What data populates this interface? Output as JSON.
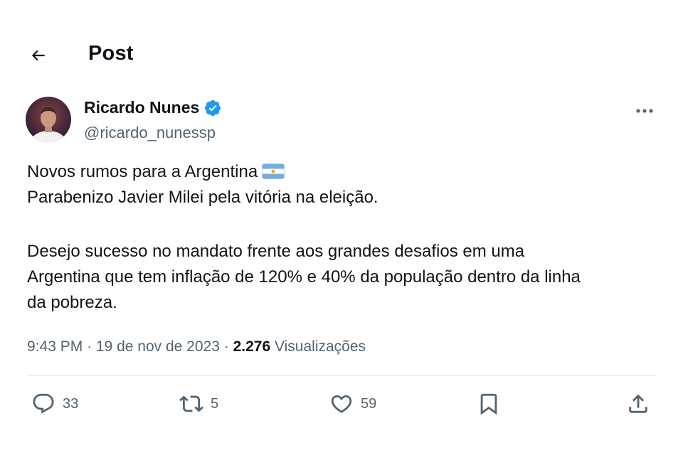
{
  "header": {
    "title": "Post"
  },
  "author": {
    "name": "Ricardo Nunes",
    "handle": "@ricardo_nunessp"
  },
  "tweet": {
    "line1": "Novos rumos para a Argentina",
    "line2": "Parabenizo Javier Milei pela vitória na eleição.",
    "line3": "Desejo sucesso no mandato frente aos grandes desafios em uma",
    "line4": "Argentina que tem inflação de 120% e 40% da população dentro da linha",
    "line5": "da pobreza."
  },
  "meta": {
    "time": "9:43 PM",
    "separator": "·",
    "date": "19 de nov de 2023",
    "views_count": "2.276",
    "views_label": "Visualizações"
  },
  "actions": {
    "replies": "33",
    "reposts": "5",
    "likes": "59"
  },
  "colors": {
    "text": "#0f1419",
    "secondary": "#536471",
    "verified": "#1d9bf0"
  }
}
